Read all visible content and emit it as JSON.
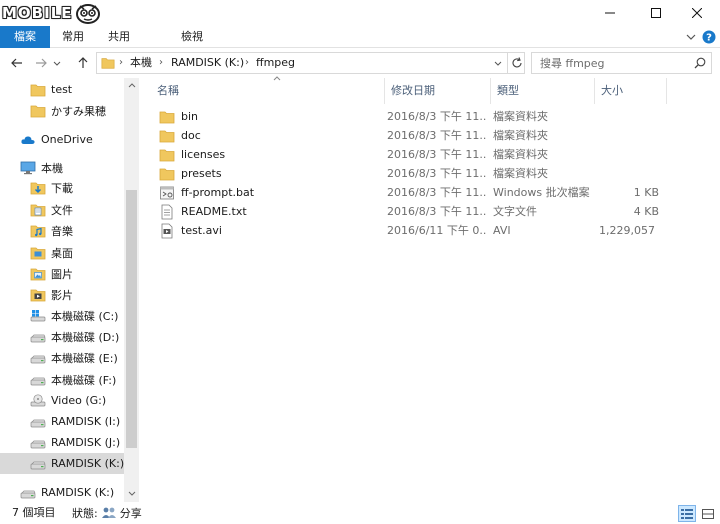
{
  "window": {
    "logo_text": "MOBILE"
  },
  "ribbon": {
    "tabs": [
      "檔案",
      "常用",
      "共用",
      "檢視"
    ]
  },
  "address": {
    "crumbs": [
      "本機",
      "RAMDISK (K:)",
      "ffmpeg"
    ]
  },
  "search": {
    "placeholder": "搜尋 ffmpeg"
  },
  "navpane": {
    "items": [
      {
        "label": "test",
        "icon": "folder-icon"
      },
      {
        "label": "かすみ果穂",
        "icon": "folder-icon"
      },
      {
        "label": "OneDrive",
        "icon": "cloud-icon"
      },
      {
        "label": "本機",
        "icon": "computer-icon"
      },
      {
        "label": "下載",
        "icon": "download-folder-icon"
      },
      {
        "label": "文件",
        "icon": "documents-folder-icon"
      },
      {
        "label": "音樂",
        "icon": "music-folder-icon"
      },
      {
        "label": "桌面",
        "icon": "desktop-folder-icon"
      },
      {
        "label": "圖片",
        "icon": "pictures-folder-icon"
      },
      {
        "label": "影片",
        "icon": "videos-folder-icon"
      },
      {
        "label": "本機磁碟 (C:)",
        "icon": "windows-drive-icon"
      },
      {
        "label": "本機磁碟 (D:)",
        "icon": "drive-icon"
      },
      {
        "label": "本機磁碟 (E:)",
        "icon": "drive-icon"
      },
      {
        "label": "本機磁碟 (F:)",
        "icon": "drive-icon"
      },
      {
        "label": "Video (G:)",
        "icon": "disc-drive-icon"
      },
      {
        "label": "RAMDISK (I:)",
        "icon": "drive-icon"
      },
      {
        "label": "RAMDISK (J:)",
        "icon": "drive-icon"
      },
      {
        "label": "RAMDISK (K:)",
        "icon": "drive-icon",
        "selected": true
      },
      {
        "label": "RAMDISK (K:)",
        "icon": "drive-icon"
      }
    ]
  },
  "filelist": {
    "columns": [
      "名稱",
      "修改日期",
      "類型",
      "大小"
    ],
    "rows": [
      {
        "name": "bin",
        "date": "2016/8/3 下午 11...",
        "type": "檔案資料夾",
        "size": "",
        "icon": "folder-icon"
      },
      {
        "name": "doc",
        "date": "2016/8/3 下午 11...",
        "type": "檔案資料夾",
        "size": "",
        "icon": "folder-icon"
      },
      {
        "name": "licenses",
        "date": "2016/8/3 下午 11...",
        "type": "檔案資料夾",
        "size": "",
        "icon": "folder-icon"
      },
      {
        "name": "presets",
        "date": "2016/8/3 下午 11...",
        "type": "檔案資料夾",
        "size": "",
        "icon": "folder-icon"
      },
      {
        "name": "ff-prompt.bat",
        "date": "2016/8/3 下午 11...",
        "type": "Windows 批次檔案",
        "size": "1 KB",
        "icon": "batch-file-icon"
      },
      {
        "name": "README.txt",
        "date": "2016/8/3 下午 11...",
        "type": "文字文件",
        "size": "4 KB",
        "icon": "text-file-icon"
      },
      {
        "name": "test.avi",
        "date": "2016/6/11 下午 0...",
        "type": "AVI",
        "size": "1,229,057 ...",
        "icon": "video-file-icon"
      }
    ]
  },
  "status": {
    "item_count": "7 個項目",
    "state_label": "狀態:",
    "state_value": "分享"
  },
  "colors": {
    "accent": "#1979ca",
    "folder": "#f0c75e",
    "header_text": "#4c607a"
  }
}
